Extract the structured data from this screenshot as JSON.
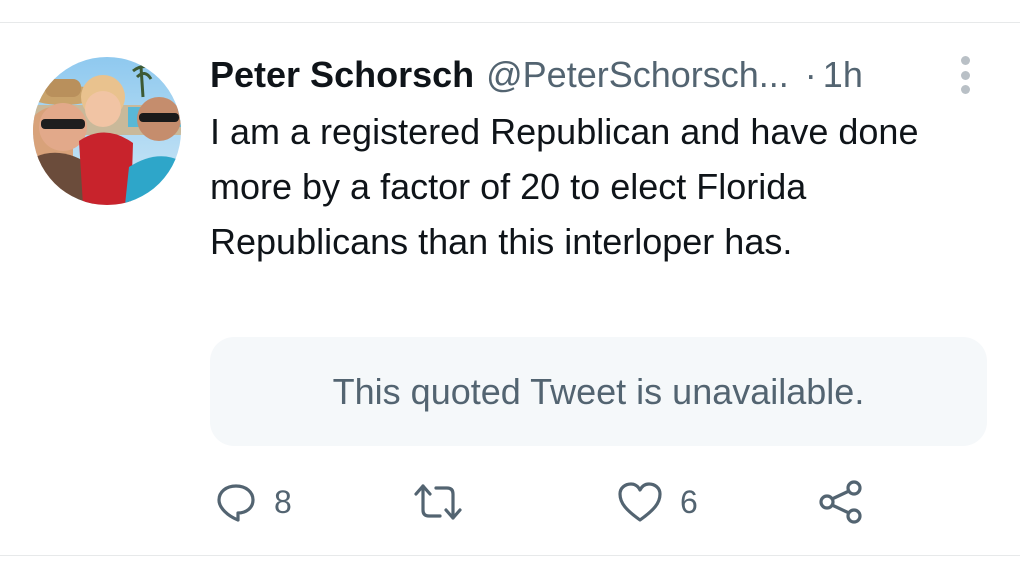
{
  "tweet": {
    "author": {
      "display_name": "Peter Schorsch",
      "handle": "@PeterSchorsch...",
      "avatar_icon": "profile-photo"
    },
    "separator": "·",
    "time": "1h",
    "text": "I am a registered Republican and have done more by a factor of 20 to elect Florida Republicans than this interloper has.",
    "quote": {
      "text": "This quoted Tweet is unavailable."
    },
    "actions": {
      "reply": {
        "icon": "reply-icon",
        "count": "8"
      },
      "retweet": {
        "icon": "retweet-icon",
        "count": ""
      },
      "like": {
        "icon": "heart-icon",
        "count": "6"
      },
      "share": {
        "icon": "share-icon"
      }
    },
    "more_icon": "more-vertical-icon"
  },
  "colors": {
    "text_primary": "#0f1419",
    "text_secondary": "#536471",
    "quote_bg": "#f5f8fa",
    "divider": "#e7e9ea"
  }
}
